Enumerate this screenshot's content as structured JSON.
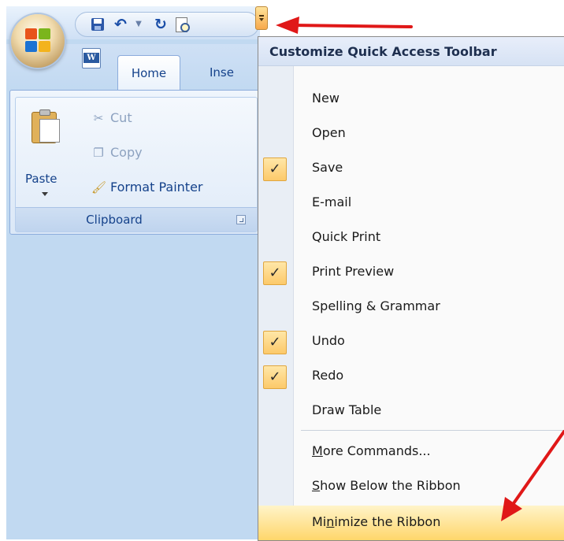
{
  "quick_access_toolbar": {
    "icons": [
      "save-icon",
      "undo-icon",
      "redo-icon",
      "print-preview-icon",
      "customize-dropdown-icon"
    ]
  },
  "tabs": {
    "home": "Home",
    "insert": "Inse"
  },
  "clipboard": {
    "paste_label": "Paste",
    "cut_label": "Cut",
    "copy_label": "Copy",
    "format_painter_label": "Format Painter",
    "group_label": "Clipboard"
  },
  "menu": {
    "title": "Customize Quick Access Toolbar",
    "items": [
      {
        "label": "New",
        "checked": false
      },
      {
        "label": "Open",
        "checked": false
      },
      {
        "label": "Save",
        "checked": true,
        "check_mark": "✓"
      },
      {
        "label": "E-mail",
        "checked": false
      },
      {
        "label": "Quick Print",
        "checked": false
      },
      {
        "label": "Print Preview",
        "checked": true,
        "check_mark": "✓"
      },
      {
        "label": "Spelling & Grammar",
        "checked": false
      },
      {
        "label": "Undo",
        "checked": true,
        "check_mark": "✓"
      },
      {
        "label": "Redo",
        "checked": true,
        "check_mark": "✓"
      },
      {
        "label": "Draw Table",
        "checked": false
      }
    ],
    "more_commands": {
      "accel": "M",
      "rest": "ore Commands..."
    },
    "show_below": {
      "accel": "S",
      "rest": "how Below the Ribbon"
    },
    "minimize": {
      "pre": "Mi",
      "accel": "n",
      "rest": "imize the Ribbon"
    }
  },
  "colors": {
    "accent_highlight": "#ffd66b",
    "annotation_arrow": "#e01818",
    "ribbon_text": "#15428b"
  }
}
